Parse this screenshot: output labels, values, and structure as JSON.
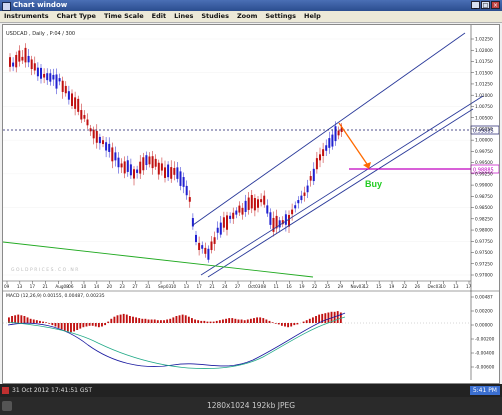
{
  "window": {
    "title": "Chart window"
  },
  "menu": [
    "Instruments",
    "Chart Type",
    "Time Scale",
    "Edit",
    "Lines",
    "Studies",
    "Zoom",
    "Settings",
    "Help"
  ],
  "chart": {
    "symbol_label": "USDCAD , Daily , P:04 / 300",
    "x_ticks": [
      "09",
      "13",
      "17",
      "21",
      "Aug08",
      "06",
      "10",
      "14",
      "20",
      "23",
      "27",
      "31",
      "Sep03",
      "10",
      "13",
      "17",
      "21",
      "24",
      "27",
      "Oct03",
      "08",
      "11",
      "16",
      "19",
      "22",
      "25",
      "29",
      "Nov03",
      "12",
      "15",
      "19",
      "22",
      "26",
      "Dec03",
      "10",
      "13",
      "17"
    ],
    "y_ticks": [
      "1.02250",
      "1.02000",
      "1.01750",
      "1.01500",
      "1.01250",
      "1.01000",
      "1.00750",
      "1.00500",
      "1.00250",
      "1.00000",
      "0.99750",
      "0.99500",
      "0.99250",
      "0.99000",
      "0.98750",
      "0.98500",
      "0.98250",
      "0.98000",
      "0.97750",
      "0.97500",
      "0.97250",
      "0.97000"
    ],
    "price_box": "0.99885",
    "target_box": "0.98885",
    "annotation": "Buy",
    "watermark": "GOLDPRICES.CO.NR",
    "colors": {
      "up": "#2020d0",
      "down": "#c01010",
      "channel": "#2a3a9a",
      "arrow": "#ff6a00",
      "target": "#c000c0",
      "buy": "#22cc22"
    }
  },
  "macd": {
    "label": "MACD (12,26,9) 0.00155, 0.00487, 0.00235",
    "y_ticks": [
      "0.00487",
      "0.00200",
      "0.00000",
      "-0.00200",
      "-0.00400",
      "-0.00600"
    ],
    "hist": [
      0.8,
      1.0,
      1.1,
      1.2,
      1.1,
      1.0,
      0.8,
      0.6,
      0.5,
      0.4,
      0.3,
      0.2,
      0.1,
      -0.1,
      -0.3,
      -0.5,
      -0.7,
      -0.9,
      -1.1,
      -1.2,
      -1.3,
      -1.2,
      -1.0,
      -0.8,
      -0.6,
      -0.5,
      -0.4,
      -0.4,
      -0.5,
      -0.6,
      -0.5,
      -0.3,
      0.2,
      0.6,
      0.9,
      1.1,
      1.2,
      1.3,
      1.2,
      1.0,
      0.9,
      0.8,
      0.7,
      0.6,
      0.6,
      0.5,
      0.5,
      0.5,
      0.4,
      0.4,
      0.4,
      0.5,
      0.6,
      0.8,
      1.0,
      1.1,
      1.2,
      1.1,
      0.9,
      0.7,
      0.5,
      0.4,
      0.3,
      0.3,
      0.2,
      0.2,
      0.2,
      0.3,
      0.4,
      0.5,
      0.6,
      0.7,
      0.7,
      0.6,
      0.5,
      0.5,
      0.4,
      0.5,
      0.6,
      0.7,
      0.8,
      0.8,
      0.7,
      0.5,
      0.3,
      0.1,
      -0.1,
      -0.2,
      -0.4,
      -0.5,
      -0.6,
      -0.5,
      -0.3,
      -0.2,
      0.0,
      0.2,
      0.4,
      0.6,
      0.8,
      1.0,
      1.2,
      1.3,
      1.4,
      1.5,
      1.6,
      1.6,
      1.7,
      1.5
    ]
  },
  "status": {
    "timestamp": "31 Oct 2012 17:41:51 GST",
    "clock": "5:41 PM"
  },
  "footer": {
    "text": "1280x1024  192kb  JPEG"
  }
}
